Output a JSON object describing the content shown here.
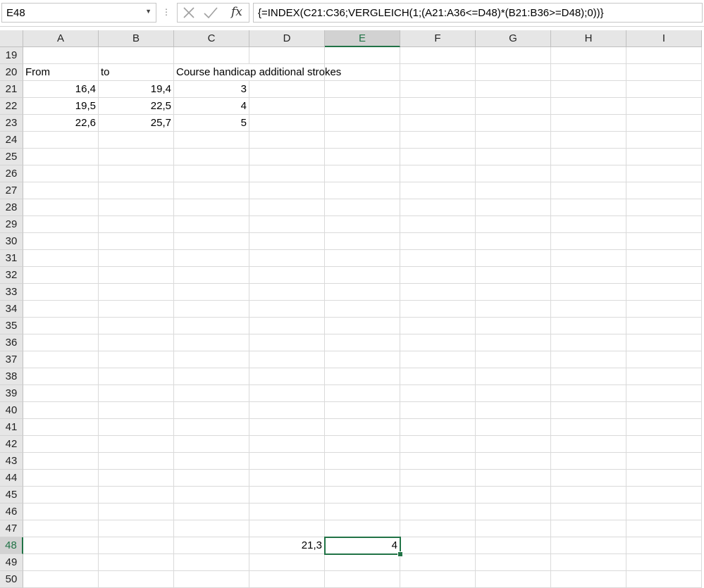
{
  "formula_bar": {
    "name_box": "E48",
    "fx_label": "fx",
    "formula": "{=INDEX(C21:C36;VERGLEICH(1;(A21:A36<=D48)*(B21:B36>=D48);0))}"
  },
  "sheet": {
    "columns": [
      "A",
      "B",
      "C",
      "D",
      "E",
      "F",
      "G",
      "H",
      "I"
    ],
    "first_row": 19,
    "last_row": 50,
    "active_cell": {
      "col": "E",
      "row": 48
    },
    "cells": [
      {
        "ref": "A20",
        "value": "From",
        "type": "text"
      },
      {
        "ref": "B20",
        "value": "to",
        "type": "text"
      },
      {
        "ref": "C20",
        "value": "Course handicap additional strokes",
        "type": "text"
      },
      {
        "ref": "A21",
        "value": "16,4",
        "type": "number"
      },
      {
        "ref": "B21",
        "value": "19,4",
        "type": "number"
      },
      {
        "ref": "C21",
        "value": "3",
        "type": "number"
      },
      {
        "ref": "A22",
        "value": "19,5",
        "type": "number"
      },
      {
        "ref": "B22",
        "value": "22,5",
        "type": "number"
      },
      {
        "ref": "C22",
        "value": "4",
        "type": "number"
      },
      {
        "ref": "A23",
        "value": "22,6",
        "type": "number"
      },
      {
        "ref": "B23",
        "value": "25,7",
        "type": "number"
      },
      {
        "ref": "C23",
        "value": "5",
        "type": "number"
      },
      {
        "ref": "D48",
        "value": "21,3",
        "type": "number"
      },
      {
        "ref": "E48",
        "value": "4",
        "type": "number"
      }
    ]
  },
  "colors": {
    "accent": "#217346",
    "header_bg": "#e6e6e6",
    "gridline": "#dadada"
  }
}
